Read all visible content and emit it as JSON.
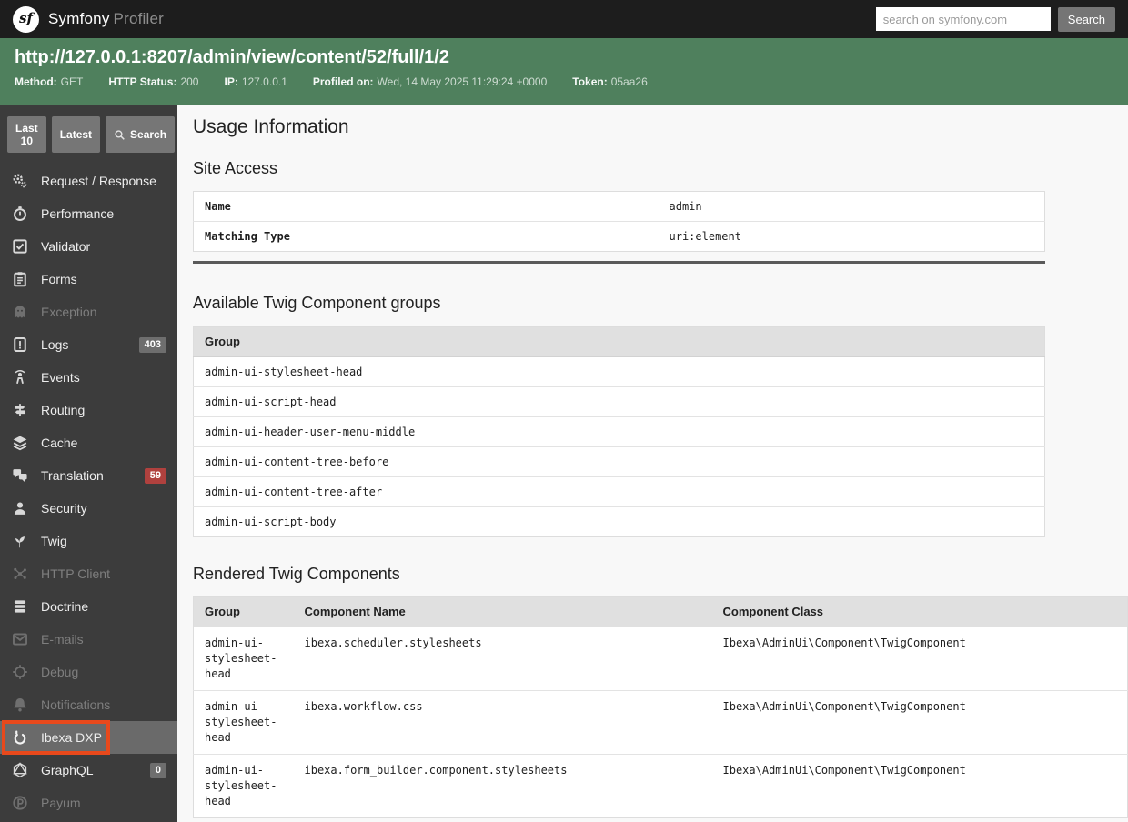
{
  "topbar": {
    "logo_glyph": "sf",
    "brand": "Symfony",
    "brand_suffix": "Profiler",
    "search_placeholder": "search on symfony.com",
    "search_button": "Search"
  },
  "request_bar": {
    "url": "http://127.0.0.1:8207/admin/view/content/52/full/1/2",
    "meta": [
      {
        "label": "Method:",
        "value": "GET"
      },
      {
        "label": "HTTP Status:",
        "value": "200"
      },
      {
        "label": "IP:",
        "value": "127.0.0.1"
      },
      {
        "label": "Profiled on:",
        "value": "Wed, 14 May 2025 11:29:24 +0000"
      },
      {
        "label": "Token:",
        "value": "05aa26"
      }
    ]
  },
  "sidebar": {
    "buttons": [
      {
        "label": "Last 10"
      },
      {
        "label": "Latest"
      },
      {
        "label": "Search",
        "icon": "magnifier-icon"
      }
    ],
    "items": [
      {
        "label": "Request / Response",
        "icon": "gears-icon"
      },
      {
        "label": "Performance",
        "icon": "stopwatch-icon"
      },
      {
        "label": "Validator",
        "icon": "checkbox-icon"
      },
      {
        "label": "Forms",
        "icon": "clipboard-icon"
      },
      {
        "label": "Exception",
        "icon": "ghost-icon",
        "disabled": true
      },
      {
        "label": "Logs",
        "icon": "log-icon",
        "badge": "403",
        "badge_color": "gray"
      },
      {
        "label": "Events",
        "icon": "broadcast-icon"
      },
      {
        "label": "Routing",
        "icon": "signpost-icon"
      },
      {
        "label": "Cache",
        "icon": "layers-icon"
      },
      {
        "label": "Translation",
        "icon": "translation-icon",
        "badge": "59",
        "badge_color": "red"
      },
      {
        "label": "Security",
        "icon": "person-icon"
      },
      {
        "label": "Twig",
        "icon": "twig-icon"
      },
      {
        "label": "HTTP Client",
        "icon": "molecule-icon",
        "disabled": true
      },
      {
        "label": "Doctrine",
        "icon": "database-icon"
      },
      {
        "label": "E-mails",
        "icon": "envelope-icon",
        "disabled": true
      },
      {
        "label": "Debug",
        "icon": "crosshair-icon",
        "disabled": true
      },
      {
        "label": "Notifications",
        "icon": "bell-icon",
        "disabled": true
      },
      {
        "label": "Ibexa DXP",
        "icon": "ibexa-icon",
        "selected": true,
        "highlighted": true
      },
      {
        "label": "GraphQL",
        "icon": "graphql-icon",
        "badge": "0",
        "badge_color": "gray"
      },
      {
        "label": "Payum",
        "icon": "payum-icon",
        "disabled": true
      }
    ]
  },
  "main": {
    "title": "Usage Information",
    "site_access": {
      "heading": "Site Access",
      "rows": [
        {
          "label": "Name",
          "value": "admin"
        },
        {
          "label": "Matching Type",
          "value": "uri:element"
        }
      ]
    },
    "twig_groups": {
      "heading": "Available Twig Component groups",
      "column": "Group",
      "rows": [
        "admin-ui-stylesheet-head",
        "admin-ui-script-head",
        "admin-ui-header-user-menu-middle",
        "admin-ui-content-tree-before",
        "admin-ui-content-tree-after",
        "admin-ui-script-body"
      ]
    },
    "rendered_components": {
      "heading": "Rendered Twig Components",
      "columns": [
        "Group",
        "Component Name",
        "Component Class"
      ],
      "rows": [
        {
          "group": "admin-ui-stylesheet-head",
          "name": "ibexa.scheduler.stylesheets",
          "class": "Ibexa\\AdminUi\\Component\\TwigComponent"
        },
        {
          "group": "admin-ui-stylesheet-head",
          "name": "ibexa.workflow.css",
          "class": "Ibexa\\AdminUi\\Component\\TwigComponent"
        },
        {
          "group": "admin-ui-stylesheet-head",
          "name": "ibexa.form_builder.component.stylesheets",
          "class": "Ibexa\\AdminUi\\Component\\TwigComponent"
        }
      ]
    }
  },
  "colors": {
    "topbar_bg": "#1d1d1d",
    "request_bar_bg": "#4f805d",
    "sidebar_bg": "#3c3c3c",
    "sidebar_selected_bg": "#6a6a6a",
    "annotation_highlight": "#e8491c",
    "badge_gray": "#6e6e6e",
    "badge_red": "#b0413e",
    "table_header_bg": "#e0e0e0"
  }
}
